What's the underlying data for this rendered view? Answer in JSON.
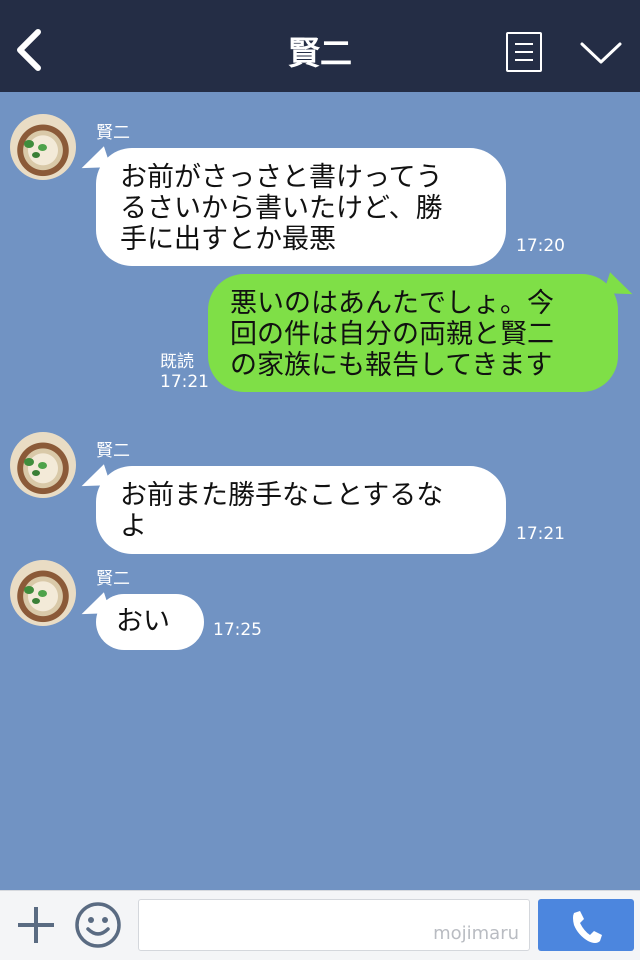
{
  "header": {
    "title": "賢二",
    "back_icon": "chevron-left-icon",
    "menu_icon": "menu-icon",
    "dropdown_icon": "chevron-down-icon"
  },
  "colors": {
    "header_bg": "#242d45",
    "chat_bg": "#7193c3",
    "incoming_bubble": "#ffffff",
    "outgoing_bubble": "#7fdf47",
    "send_button": "#4c86de"
  },
  "messages": [
    {
      "direction": "incoming",
      "sender": "賢二",
      "text": "お前がさっさと書けってう\nるさいから書いたけど、勝\n手に出すとか最悪",
      "time": "17:20"
    },
    {
      "direction": "outgoing",
      "text": "悪いのはあんたでしょ。今\n回の件は自分の両親と賢二\nの家族にも報告してきます",
      "read": "既読",
      "time": "17:21"
    },
    {
      "direction": "incoming",
      "sender": "賢二",
      "text": "お前また勝手なことするな\nよ",
      "time": "17:21"
    },
    {
      "direction": "incoming",
      "sender": "賢二",
      "text": "おい",
      "time": "17:25"
    }
  ],
  "footer": {
    "plus_icon": "plus-icon",
    "emoji_icon": "smiley-icon",
    "input_value": "",
    "watermark": "mojimaru",
    "send_icon": "phone-icon"
  }
}
